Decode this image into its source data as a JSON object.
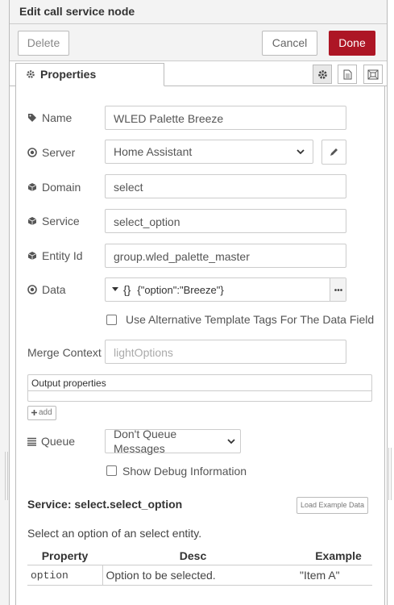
{
  "dialog": {
    "title": "Edit call service node",
    "delete_label": "Delete",
    "cancel_label": "Cancel",
    "done_label": "Done"
  },
  "tabs": {
    "properties_label": "Properties",
    "icons": [
      "gear-icon",
      "document-icon",
      "frame-icon"
    ]
  },
  "form": {
    "name": {
      "label": "Name",
      "value": "WLED Palette Breeze"
    },
    "server": {
      "label": "Server",
      "value": "Home Assistant"
    },
    "domain": {
      "label": "Domain",
      "value": "select"
    },
    "service": {
      "label": "Service",
      "value": "select_option"
    },
    "entity": {
      "label": "Entity Id",
      "value": "group.wled_palette_master"
    },
    "data": {
      "label": "Data",
      "type_symbol": "{}",
      "value": "{\"option\":\"Breeze\"}"
    },
    "alt_tags": {
      "label": "Use Alternative Template Tags For The Data Field",
      "checked": false
    },
    "merge_context": {
      "label": "Merge Context",
      "placeholder": "lightOptions"
    },
    "output_properties": {
      "label": "Output properties",
      "add_label": "add"
    },
    "queue": {
      "label": "Queue",
      "value": "Don't Queue Messages"
    },
    "debug": {
      "label": "Show Debug Information",
      "checked": false
    }
  },
  "help": {
    "title": "Service: select.select_option",
    "load_example_label": "Load Example Data",
    "description": "Select an option of an select entity.",
    "columns": [
      "Property",
      "Desc",
      "Example"
    ],
    "rows": [
      {
        "property": "option",
        "desc": "Option to be selected.",
        "example": "\"Item A\""
      }
    ]
  },
  "colors": {
    "primary": "#ad1625",
    "border": "#cccccc",
    "header_bg": "#f3f3f3"
  }
}
